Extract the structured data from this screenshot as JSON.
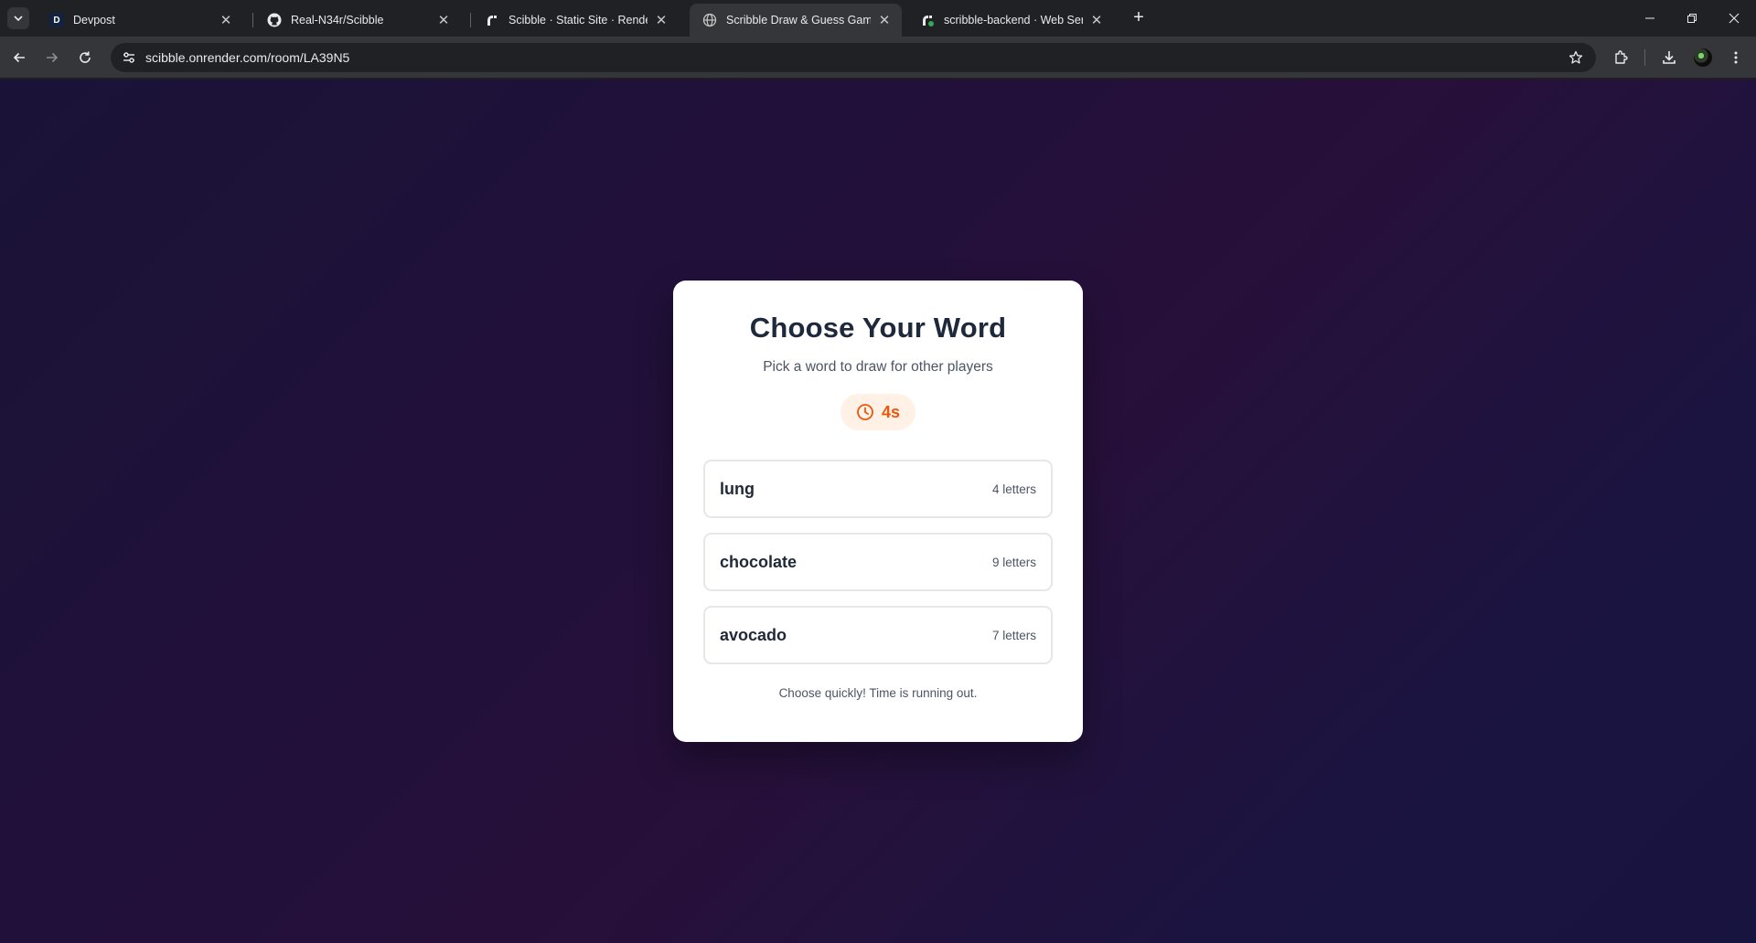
{
  "browser": {
    "tabs": [
      {
        "title": "Devpost",
        "favicon": "devpost-icon"
      },
      {
        "title": "Real-N34r/Scibble",
        "favicon": "github-icon"
      },
      {
        "title": "Scibble · Static Site · Render Da",
        "favicon": "render-icon"
      },
      {
        "title": "Scribble Draw & Guess Game",
        "favicon": "globe-icon",
        "active": true
      },
      {
        "title": "scribble-backend · Web Service",
        "favicon": "render-icon"
      }
    ],
    "favicon_letter": "D",
    "url": "scibble.onrender.com/room/LA39N5"
  },
  "card": {
    "title": "Choose Your Word",
    "subtitle": "Pick a word to draw for other players",
    "timer": "4s",
    "words": [
      {
        "word": "lung",
        "letters": "4 letters"
      },
      {
        "word": "chocolate",
        "letters": "9 letters"
      },
      {
        "word": "avocado",
        "letters": "7 letters"
      }
    ],
    "footer": "Choose quickly! Time is running out."
  },
  "colors": {
    "accent": "#ea580c",
    "card_bg": "#ffffff",
    "page_bg": "#21103a"
  }
}
